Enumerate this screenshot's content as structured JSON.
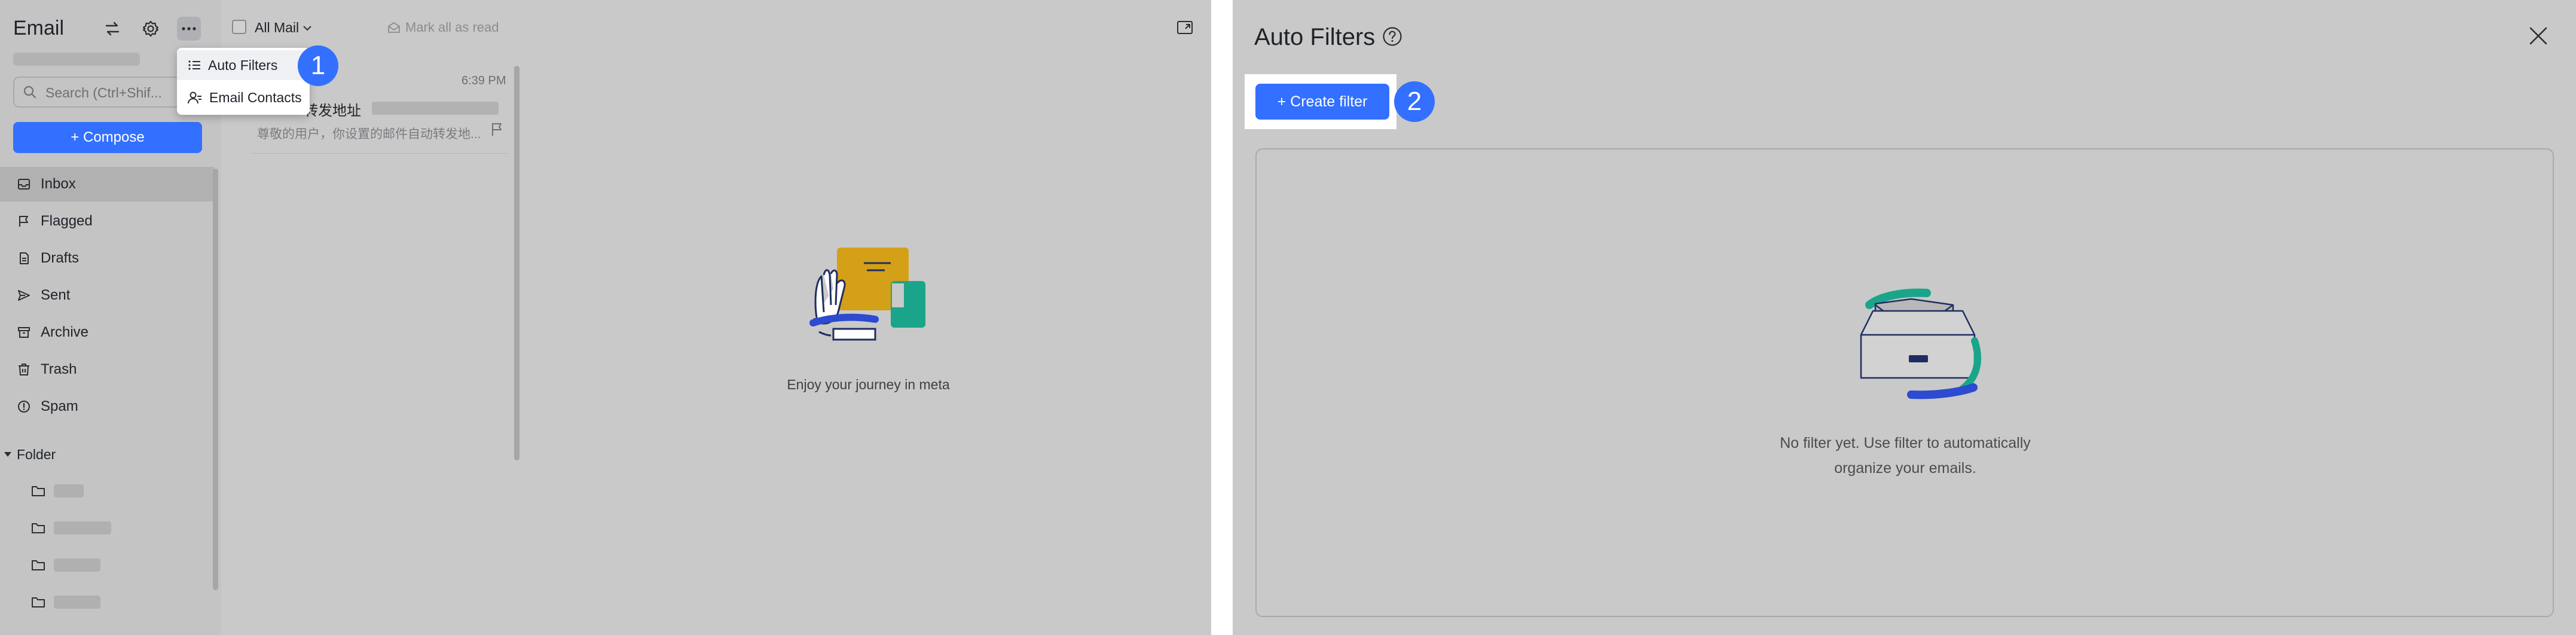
{
  "left": {
    "app_title": "Email",
    "search": {
      "placeholder": "Search (Ctrl+Shif..."
    },
    "compose_label": "+ Compose",
    "nav": [
      {
        "label": "Inbox",
        "icon": "inbox-icon",
        "active": true
      },
      {
        "label": "Flagged",
        "icon": "flag-icon"
      },
      {
        "label": "Drafts",
        "icon": "draft-icon"
      },
      {
        "label": "Sent",
        "icon": "send-icon"
      },
      {
        "label": "Archive",
        "icon": "archive-icon"
      },
      {
        "label": "Trash",
        "icon": "trash-icon"
      },
      {
        "label": "Spam",
        "icon": "spam-icon"
      }
    ],
    "folder_label": "Folder",
    "mail_list": {
      "filter_label": "All Mail",
      "mark_all_read": "Mark all as read",
      "message": {
        "time": "6:39 PM",
        "subject_fragment": "转发地址",
        "preview": "尊敬的用户，你设置的邮件自动转发地..."
      }
    },
    "dropdown": {
      "items": [
        {
          "label": "Auto Filters",
          "icon": "list-icon"
        },
        {
          "label": "Email Contacts",
          "icon": "contacts-icon"
        }
      ]
    },
    "reading_pane_caption": "Enjoy your journey in meta",
    "step_badge": "1"
  },
  "right": {
    "title": "Auto Filters",
    "create_filter_label": "+ Create filter",
    "empty_text_line1": "No filter yet. Use filter to automatically",
    "empty_text_line2": "organize your emails.",
    "step_badge": "2"
  },
  "colors": {
    "accent": "#3370ff",
    "overlay": "#c9c9c9",
    "illustration_yellow": "#d4a017",
    "illustration_teal": "#1aa58a",
    "illustration_blue": "#2c4bd0"
  }
}
